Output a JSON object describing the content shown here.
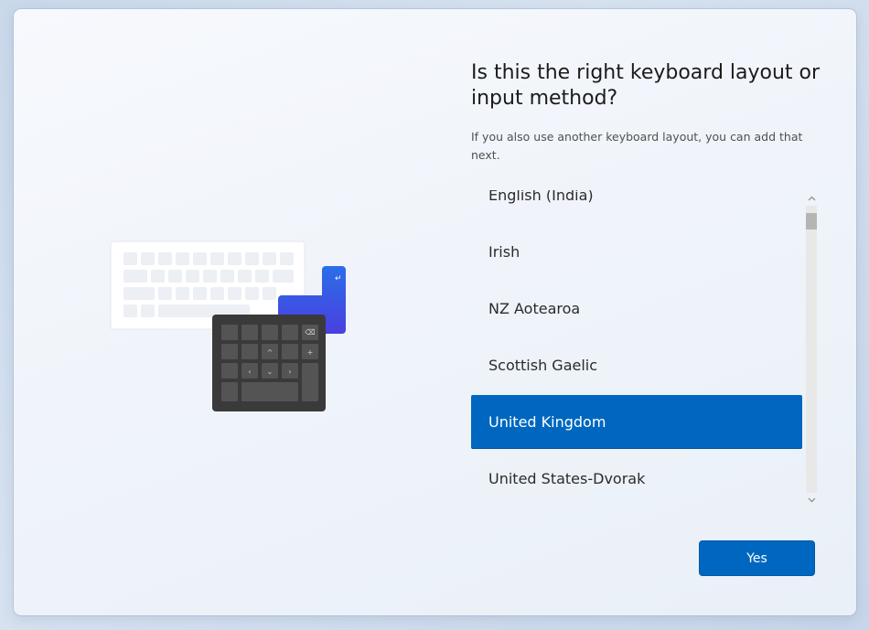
{
  "dialog": {
    "title": "Is this the right keyboard layout or input method?",
    "subtitle": "If you also use another keyboard layout, you can add that next."
  },
  "layouts": {
    "items": [
      {
        "label": "English (India)",
        "selected": false
      },
      {
        "label": "Irish",
        "selected": false
      },
      {
        "label": "NZ Aotearoa",
        "selected": false
      },
      {
        "label": "Scottish Gaelic",
        "selected": false
      },
      {
        "label": "United Kingdom",
        "selected": true
      },
      {
        "label": "United States-Dvorak",
        "selected": false
      }
    ]
  },
  "scrollbar": {
    "up_icon": "chevron-up-icon",
    "down_icon": "chevron-down-icon"
  },
  "illustration": {
    "icon": "keyboard-illustration",
    "enter_key_glyph": "↵",
    "backspace_glyph": "⌫",
    "up_glyph": "^",
    "plus_glyph": "+",
    "left_glyph": "‹",
    "down_glyph": "⌄",
    "right_glyph": "›"
  },
  "footer": {
    "yes_label": "Yes"
  },
  "colors": {
    "accent": "#0067c0",
    "enter_key_blue": "#2f5fe0",
    "numpad_dark": "#3a3a3a"
  }
}
